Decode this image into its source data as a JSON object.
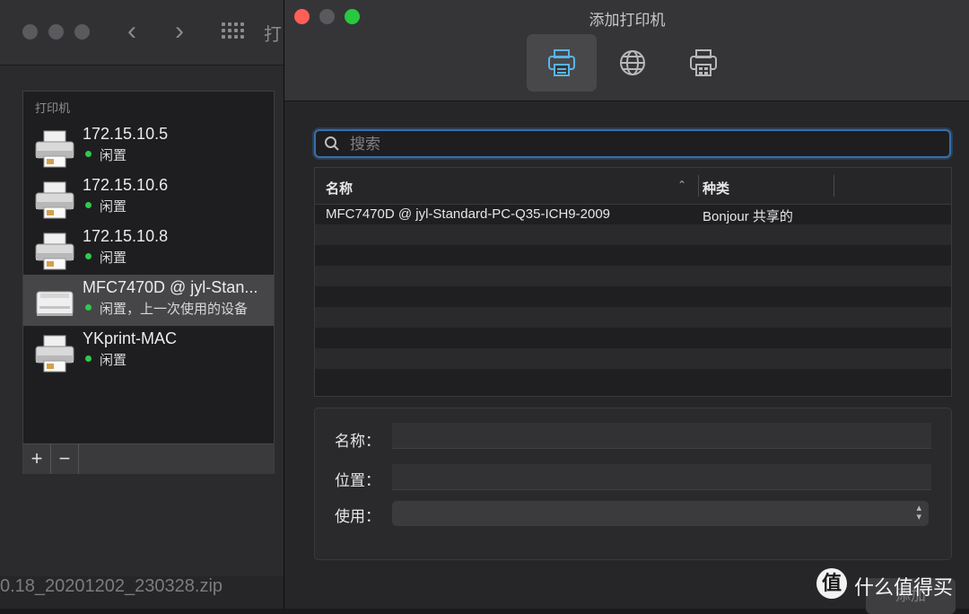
{
  "background": {
    "zip_label": "0.18_20201202_230328.zip"
  },
  "back_window": {
    "title_fragment": "打",
    "nav": {
      "back": "‹",
      "forward": "›"
    },
    "printer_list_header": "打印机",
    "printers": [
      {
        "name": "172.15.10.5",
        "status": "闲置",
        "icon": "printer-icon"
      },
      {
        "name": "172.15.10.6",
        "status": "闲置",
        "icon": "printer-icon"
      },
      {
        "name": "172.15.10.8",
        "status": "闲置",
        "icon": "printer-icon"
      },
      {
        "name": "MFC7470D @ jyl-Stan...",
        "status": "闲置，上一次使用的设备",
        "icon": "laser-printer-icon",
        "selected": true
      },
      {
        "name": "YKprint-MAC",
        "status": "闲置",
        "icon": "printer-icon"
      }
    ],
    "footer": {
      "add": "+",
      "remove": "−"
    }
  },
  "dialog": {
    "title": "添加打印机",
    "toolbar": [
      {
        "name": "default-printer-icon",
        "active": true
      },
      {
        "name": "globe-icon",
        "active": false
      },
      {
        "name": "windows-printer-icon",
        "active": false
      }
    ],
    "search": {
      "placeholder": "搜索",
      "value": ""
    },
    "table": {
      "columns": [
        "名称",
        "种类"
      ],
      "rows": [
        {
          "name": "MFC7470D @ jyl-Standard-PC-Q35-ICH9-2009",
          "kind": "Bonjour 共享的"
        }
      ]
    },
    "form": {
      "name_label": "名称：",
      "location_label": "位置：",
      "use_label": "使用："
    },
    "add_button": "添加"
  },
  "watermark": {
    "logo": "值",
    "text": "什么值得买"
  },
  "colors": {
    "close": "#ff5f57",
    "minimize": "#5a5a5e",
    "zoom": "#28c840",
    "status_green": "#30c94e",
    "accent_blue": "#3a6ea8"
  }
}
